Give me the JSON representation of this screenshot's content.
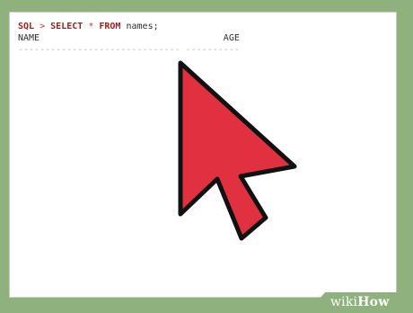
{
  "terminal": {
    "prompt_label": "SQL",
    "prompt_symbol": ">",
    "kw_select": "SELECT",
    "star": "*",
    "kw_from": "FROM",
    "table_name": "names;",
    "header_name": "NAME",
    "header_age": "AGE",
    "divider_name": "------------------------------",
    "divider_age": "----------"
  },
  "logo": {
    "wiki": "wiki",
    "how": "How"
  },
  "colors": {
    "background": "#8fb17d",
    "pointer_fill": "#e13040",
    "pointer_stroke": "#111111",
    "keyword": "#a4201e"
  },
  "icons": {
    "pointer": "mouse-pointer-icon"
  }
}
